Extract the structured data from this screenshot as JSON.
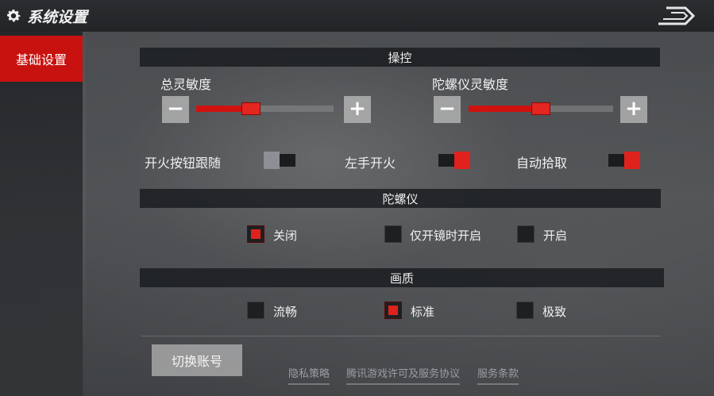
{
  "header": {
    "title": "系统设置"
  },
  "sidebar": {
    "items": [
      {
        "label": "基础设置"
      }
    ]
  },
  "controls": {
    "section_title": "操控",
    "total_sensitivity": {
      "label": "总灵敏度",
      "minus": "−",
      "plus": "+",
      "value": 0.4
    },
    "gyro_sensitivity": {
      "label": "陀螺仪灵敏度",
      "minus": "−",
      "plus": "+",
      "value": 0.5
    },
    "fire_follow": {
      "label": "开火按钮跟随",
      "on": false
    },
    "left_fire": {
      "label": "左手开火",
      "on": true
    },
    "auto_pickup": {
      "label": "自动拾取",
      "on": true
    }
  },
  "gyro": {
    "section_title": "陀螺仪",
    "options": [
      {
        "label": "关闭",
        "checked": true
      },
      {
        "label": "仅开镜时开启",
        "checked": false
      },
      {
        "label": "开启",
        "checked": false
      }
    ]
  },
  "quality": {
    "section_title": "画质",
    "options": [
      {
        "label": "流畅",
        "checked": false
      },
      {
        "label": "标准",
        "checked": true
      },
      {
        "label": "极致",
        "checked": false
      }
    ]
  },
  "footer": {
    "switch_account": "切换账号",
    "links": [
      "隐私策略",
      "腾讯游戏许可及服务协议",
      "服务条款"
    ]
  },
  "colors": {
    "accent": "#c8120f",
    "active": "#e0221c"
  }
}
